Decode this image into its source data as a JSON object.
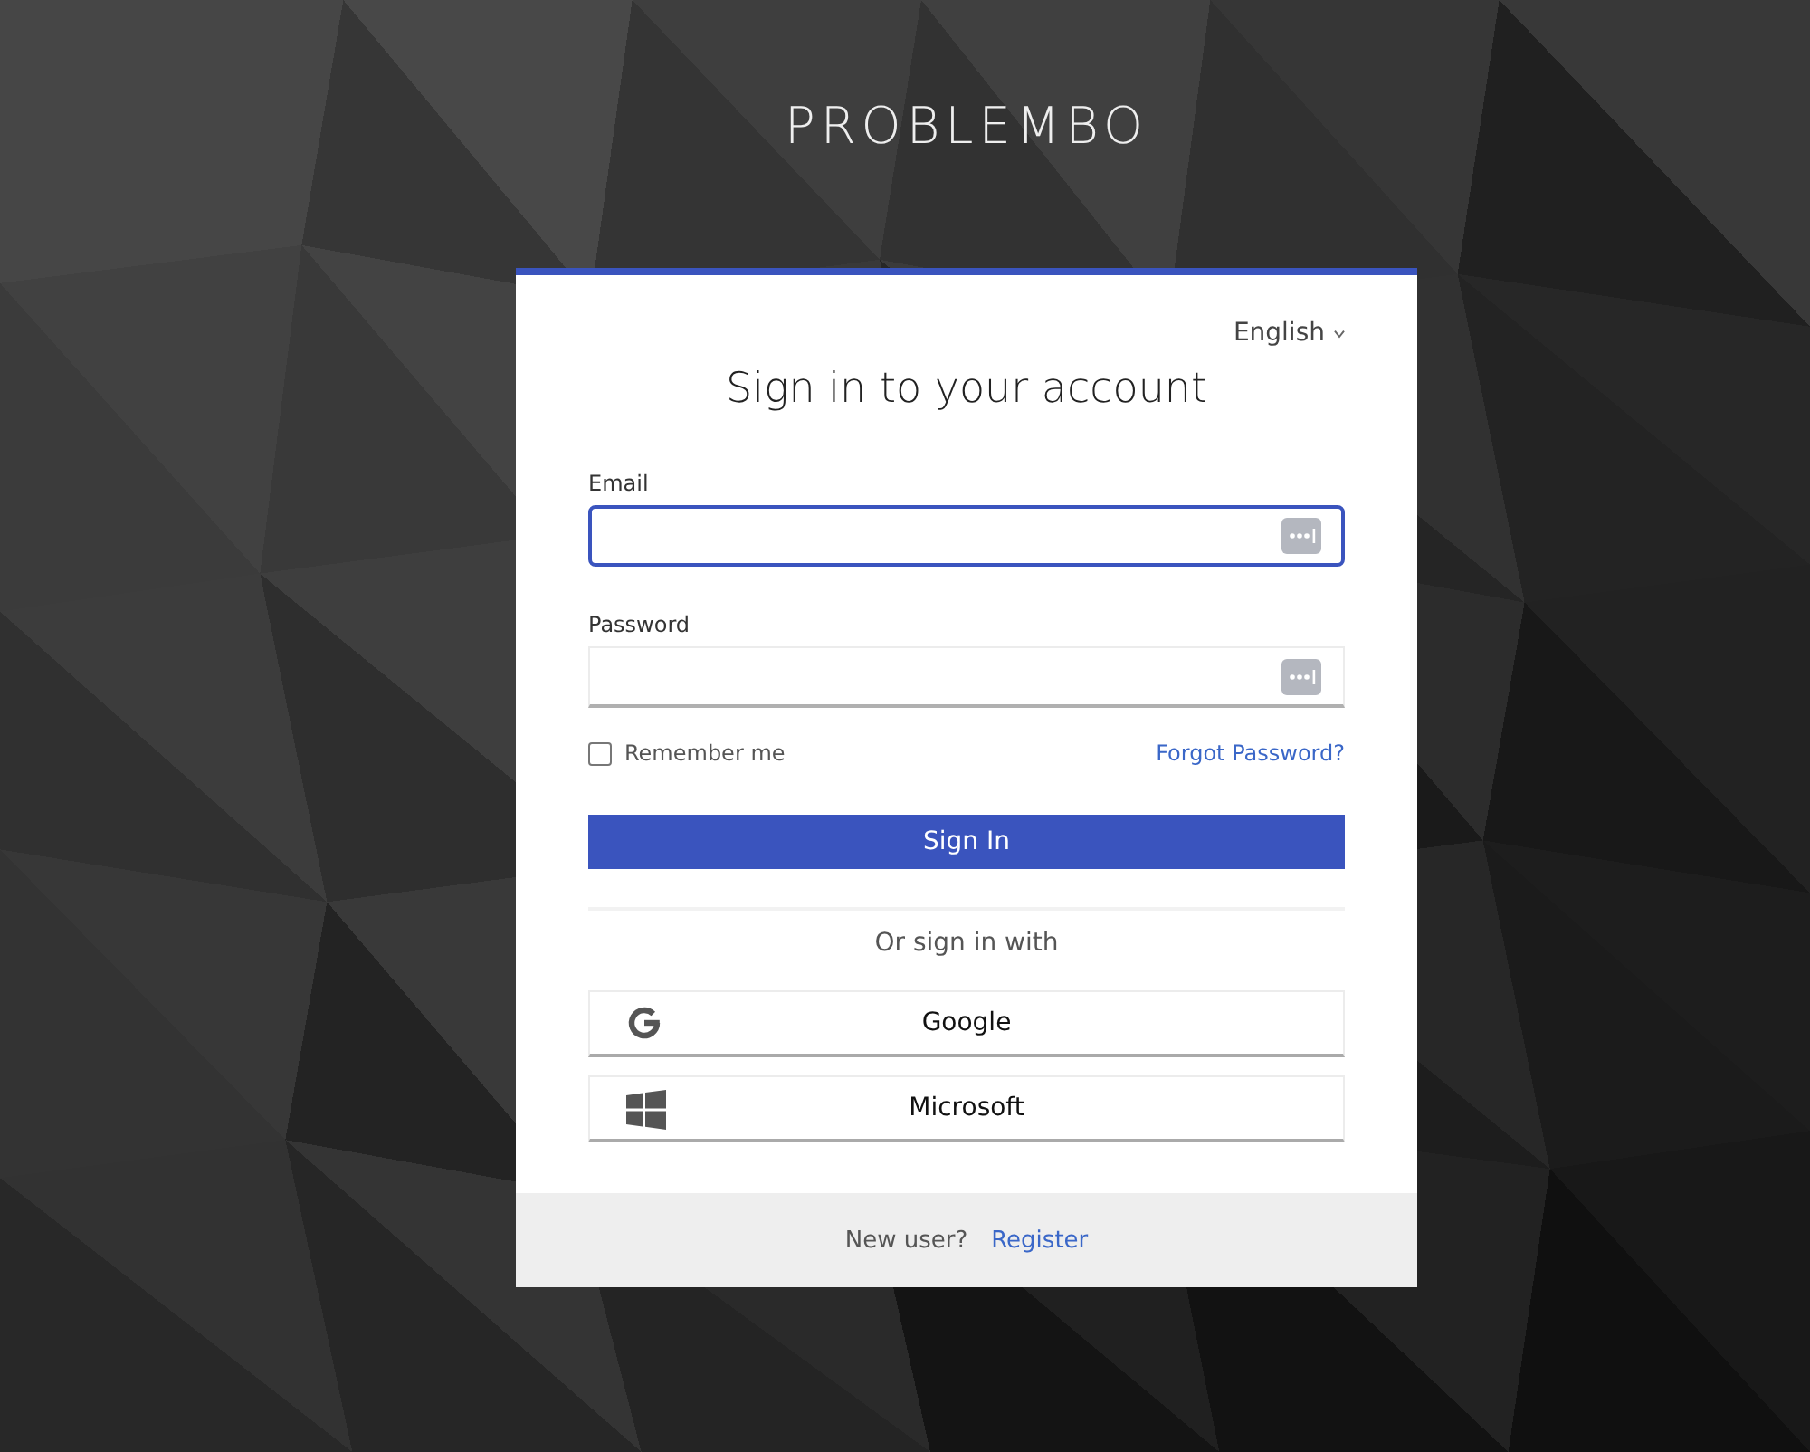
{
  "brand": "PROBLEMBO",
  "language": "English",
  "title": "Sign in to your account",
  "fields": [
    {
      "label": "Email",
      "focused": true
    },
    {
      "label": "Password",
      "focused": false
    }
  ],
  "remember": {
    "label": "Remember me",
    "checked": false
  },
  "forgot_link": "Forgot Password?",
  "submit_button": "Sign In",
  "divider_text": "Or sign in with",
  "social_buttons": [
    {
      "label": "Google",
      "kind": "google"
    },
    {
      "label": "Microsoft",
      "kind": "microsoft"
    }
  ],
  "footer": {
    "prompt": "New user?",
    "link": "Register"
  }
}
